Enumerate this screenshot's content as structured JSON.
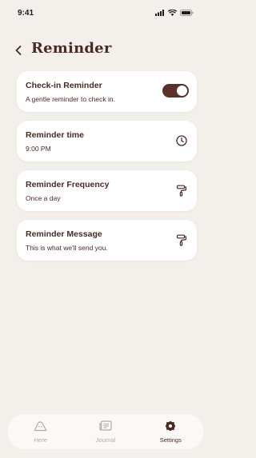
{
  "status_bar": {
    "time": "9:41"
  },
  "header": {
    "title": "Reminder"
  },
  "cards": [
    {
      "title": "Check-in Reminder",
      "subtitle": "A gentle reminder to check in.",
      "control": "toggle",
      "toggle_on": true
    },
    {
      "title": "Reminder time",
      "subtitle": "9:00 PM",
      "icon": "clock-icon"
    },
    {
      "title": "Reminder Frequency",
      "subtitle": "Once a day",
      "icon": "paint-roller-icon"
    },
    {
      "title": "Reminder Message",
      "subtitle": "This is what we'll send you.",
      "icon": "paint-roller-icon"
    }
  ],
  "bottom_nav": {
    "items": [
      {
        "label": "Here",
        "icon": "mountain-face-icon",
        "active": false
      },
      {
        "label": "Journal",
        "icon": "journal-icon",
        "active": false
      },
      {
        "label": "Settings",
        "icon": "gear-icon",
        "active": true
      }
    ]
  },
  "colors": {
    "background": "#f3efea",
    "accent": "#5a3028",
    "text": "#4a2a22",
    "inactive": "#b6aaa2"
  }
}
